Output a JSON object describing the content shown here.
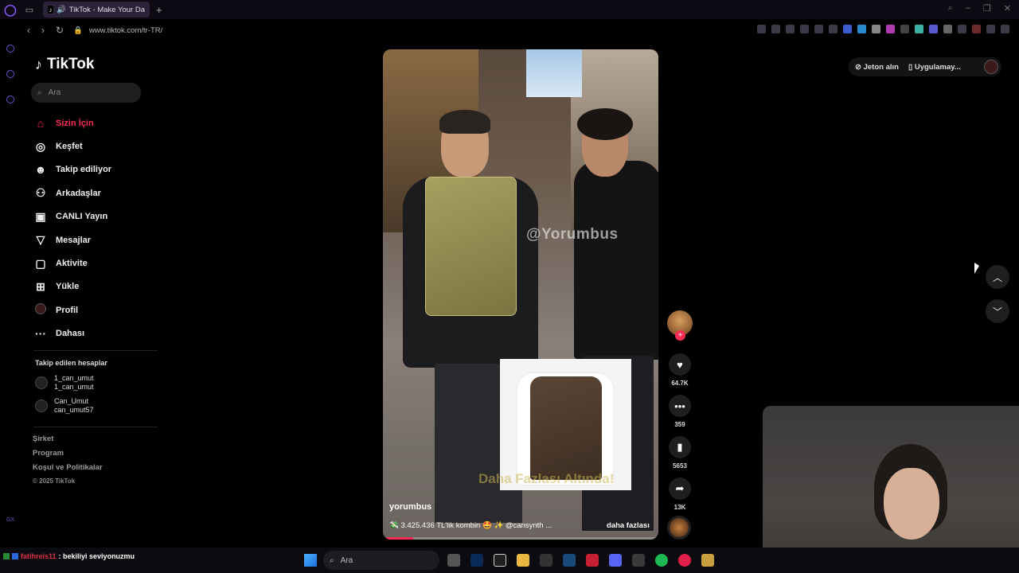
{
  "browser": {
    "tab_title": "TikTok - Make Your Da",
    "url": "www.tiktok.com/tr-TR/"
  },
  "sidebar": {
    "logo": "TikTok",
    "search_placeholder": "Ara",
    "nav": [
      {
        "label": "Sizin İçin",
        "icon": "home-icon",
        "active": true
      },
      {
        "label": "Keşfet",
        "icon": "compass-icon"
      },
      {
        "label": "Takip ediliyor",
        "icon": "user-follow-icon"
      },
      {
        "label": "Arkadaşlar",
        "icon": "friends-icon"
      },
      {
        "label": "CANLI Yayın",
        "icon": "live-tv-icon"
      },
      {
        "label": "Mesajlar",
        "icon": "message-send-icon"
      },
      {
        "label": "Aktivite",
        "icon": "activity-icon"
      },
      {
        "label": "Yükle",
        "icon": "upload-plus-icon"
      },
      {
        "label": "Profil",
        "icon": "profile-avatar"
      },
      {
        "label": "Dahası",
        "icon": "more-dots-icon"
      }
    ],
    "following_title": "Takip edilen hesaplar",
    "following": [
      {
        "name": "1_can_umut",
        "handle": "1_can_umut"
      },
      {
        "name": "Can_Umut",
        "handle": "can_umut57"
      }
    ],
    "footer": {
      "company": "Şirket",
      "program": "Program",
      "terms": "Koşul ve Politikalar",
      "copyright": "© 2025 TikTok"
    }
  },
  "video": {
    "watermark": "@Yorumbus",
    "overlay_text": "Daha Fazlası Altında!",
    "username": "yorumbus",
    "caption": "💸 3.425.436 TL'lik kombin 🤩 ✨ @cansynth ...",
    "more_label": "daha fazlası",
    "progress_fraction": 0.11
  },
  "actions": {
    "likes": "64.7K",
    "comments": "359",
    "saves": "5653",
    "shares": "13K"
  },
  "top_right": {
    "coins": "Jeton alın",
    "app": "Uygulamay..."
  },
  "taskbar": {
    "chat_user": "fatihreis11",
    "chat_message": ": bekiliyi seviyonuzmu",
    "search_placeholder": "Ara"
  },
  "colors": {
    "accent": "#fe2c55",
    "opera": "#8a5cff"
  }
}
